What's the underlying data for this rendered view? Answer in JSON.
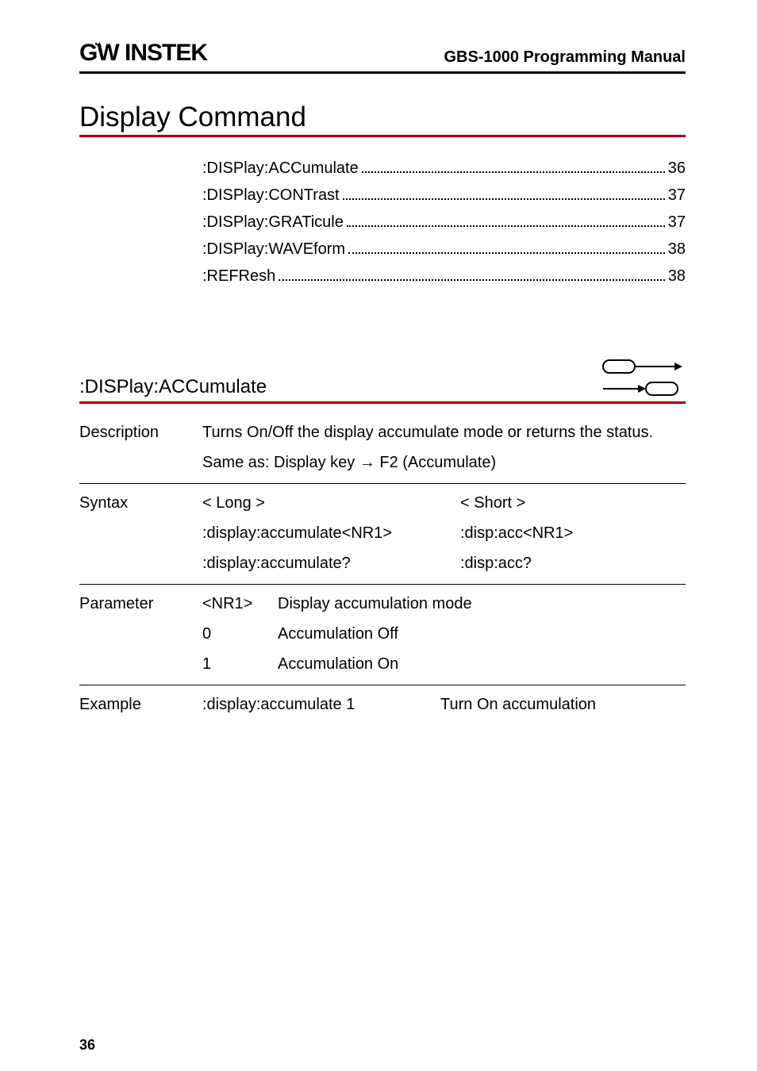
{
  "header": {
    "logo_prefix": "G",
    "logo_mid": "W",
    "logo_suffix": "INSTEK",
    "title": "GBS-1000 Programming Manual"
  },
  "chapter": "Display Command",
  "toc": [
    {
      "label": ":DISPlay:ACCumulate",
      "page": "36"
    },
    {
      "label": ":DISPlay:CONTrast",
      "page": "37"
    },
    {
      "label": ":DISPlay:GRATicule",
      "page": "37"
    },
    {
      "label": ":DISPlay:WAVEform",
      "page": "38"
    },
    {
      "label": ":REFResh",
      "page": "38"
    }
  ],
  "command": {
    "name": ":DISPlay:ACCumulate"
  },
  "sections": {
    "description": {
      "label": "Description",
      "text": "Turns On/Off the display accumulate mode or returns the status.",
      "sub": "Same as: Display key → F2 (Accumulate)"
    },
    "syntax": {
      "label": "Syntax",
      "long_hdr": "< Long >",
      "short_hdr": "< Short >",
      "long1": ":display:accumulate<NR1>",
      "short1": ":disp:acc<NR1>",
      "long2": ":display:accumulate?",
      "short2": ":disp:acc?"
    },
    "parameter": {
      "label": "Parameter",
      "rows": [
        {
          "k": "<NR1>",
          "v": "Display accumulation mode"
        },
        {
          "k": "0",
          "v": "Accumulation Off"
        },
        {
          "k": "1",
          "v": "Accumulation On"
        }
      ]
    },
    "example": {
      "label": "Example",
      "cmd": ":display:accumulate 1",
      "result": "Turn On accumulation"
    }
  },
  "page_number": "36"
}
